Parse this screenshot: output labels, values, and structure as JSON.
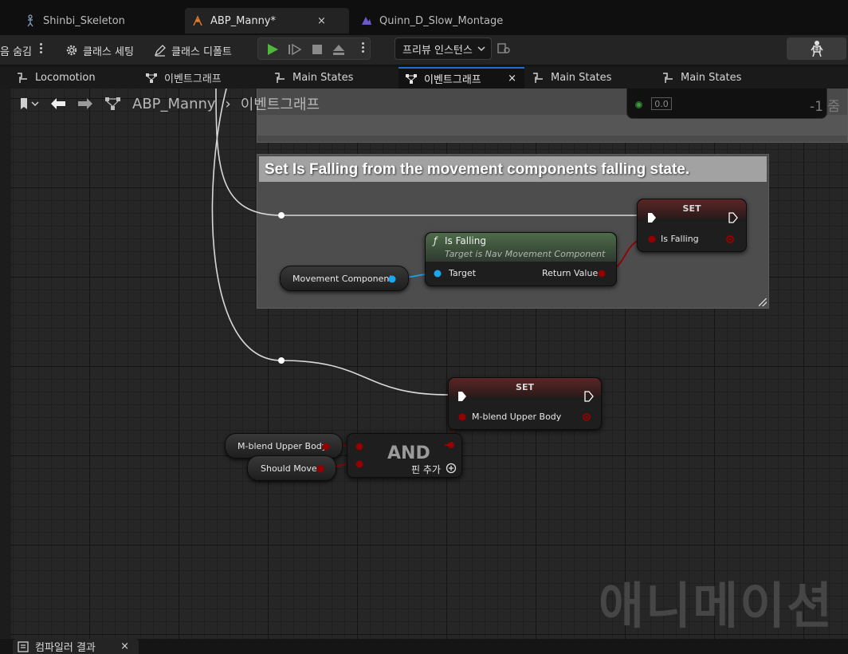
{
  "doc_tabs": [
    {
      "label": "Shinbi_Skeleton",
      "icon": "skeleton-icon"
    },
    {
      "label": "ABP_Manny*",
      "icon": "anim-blueprint-icon",
      "close": "×"
    },
    {
      "label": "Quinn_D_Slow_Montage",
      "icon": "montage-icon"
    }
  ],
  "toolbar": {
    "hide_label": "음 숨김",
    "class_settings": "클래스 세팅",
    "class_defaults": "클래스 디폴트",
    "preview_instance": "프리뷰 인스턴스"
  },
  "graph_tabs": [
    {
      "label": "Locomotion"
    },
    {
      "label": "이벤트그래프"
    },
    {
      "label": "Main States"
    },
    {
      "label": "이벤트그래프",
      "close": "×"
    },
    {
      "label": "Main States"
    },
    {
      "label": "Main States"
    }
  ],
  "breadcrumb": {
    "root": "ABP_Manny",
    "current": "이벤트그래프"
  },
  "zoom": "-1 줌",
  "float_value": "0.0",
  "comment": {
    "title": "Set Is Falling from the movement components falling state."
  },
  "nodes": {
    "set_falling": {
      "title": "SET",
      "pin": "Is Falling"
    },
    "is_falling": {
      "title": "Is Falling",
      "subtitle": "Target is Nav Movement Component",
      "target": "Target",
      "return": "Return Value"
    },
    "movement_component": "Movement Component",
    "set_blend": {
      "title": "SET",
      "pin": "M-blend Upper Body"
    },
    "blend_var": "M-blend Upper Body",
    "should_move": "Should Move",
    "and": {
      "title": "AND",
      "add_pin": "핀 추가"
    }
  },
  "watermark": "애니메이션",
  "bottom_tab": {
    "label": "컴파일러 결과",
    "close": "×"
  },
  "colors": {
    "exec": "#ffffff",
    "bool": "#950000",
    "object": "#1aa7ec",
    "float": "#3a9d3a",
    "accent": "#1d6fd8"
  }
}
